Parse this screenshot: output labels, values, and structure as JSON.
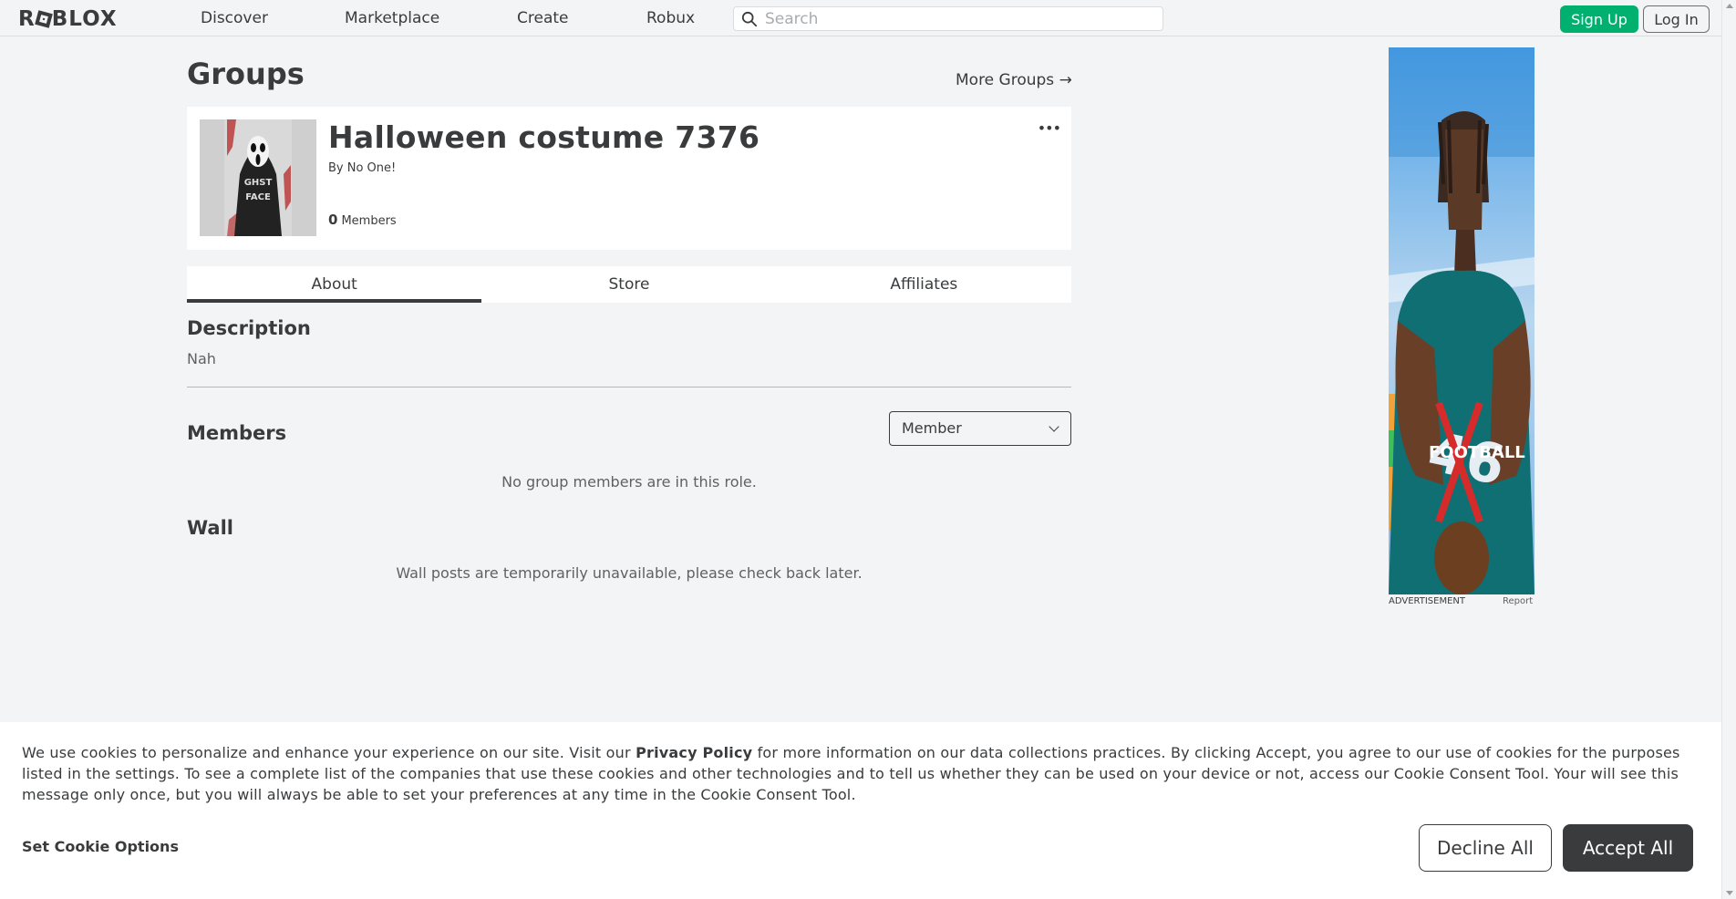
{
  "nav": {
    "logo": "ROBLOX",
    "links": [
      "Discover",
      "Marketplace",
      "Create",
      "Robux"
    ],
    "search_placeholder": "Search",
    "signup": "Sign Up",
    "login": "Log In"
  },
  "page": {
    "title": "Groups",
    "more_groups": "More Groups →"
  },
  "group": {
    "name": "Halloween costume 7376",
    "owner": "By No One!",
    "member_count": "0",
    "members_label": "Members",
    "menu_icon": "ellipsis-icon"
  },
  "tabs": [
    "About",
    "Store",
    "Affiliates"
  ],
  "about": {
    "description_heading": "Description",
    "description_text": "Nah",
    "members_heading": "Members",
    "role_selected": "Member",
    "no_members_text": "No group members are in this role.",
    "wall_heading": "Wall",
    "wall_text": "Wall posts are temporarily unavailable, please check back later."
  },
  "ad": {
    "label": "ADVERTISEMENT",
    "report": "Report"
  },
  "cookie": {
    "text_before": "We use cookies to personalize and enhance your experience on our site. Visit our ",
    "link": "Privacy Policy",
    "text_after": " for more information on our data collections practices. By clicking Accept, you agree to our use of cookies for the purposes listed in the settings. To see a complete list of the companies that use these cookies and other technologies and to tell us whether they can be used on your device or not, access our Cookie Consent Tool. Your will see this message only once, but you will always be able to set your preferences at any time in the Cookie Consent Tool.",
    "set_options": "Set Cookie Options",
    "decline": "Decline All",
    "accept": "Accept All"
  },
  "colors": {
    "background": "#f2f4f5",
    "signup_green": "#00b06f",
    "text_dark": "#393b3d"
  }
}
